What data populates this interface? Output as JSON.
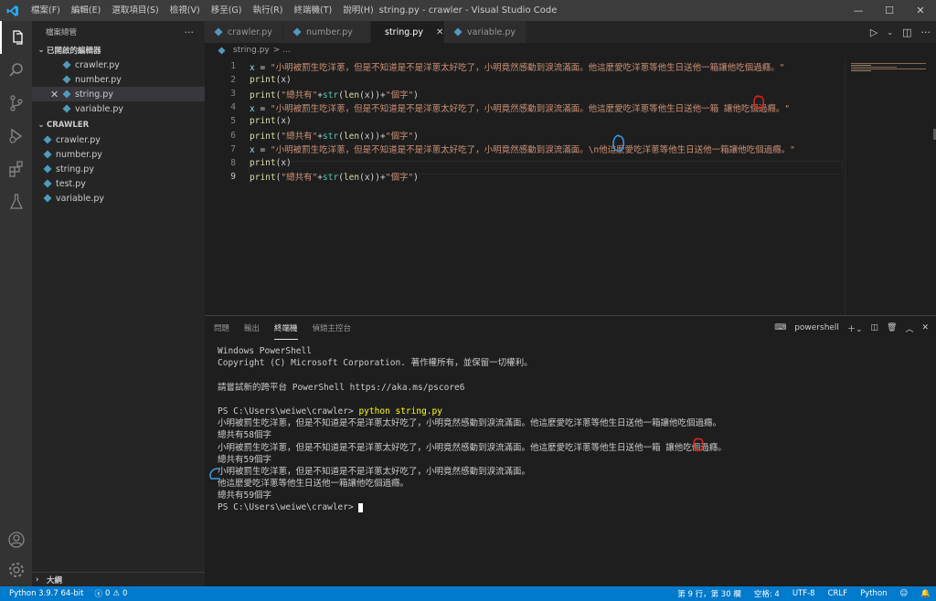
{
  "titlebar": {
    "menus": [
      "檔案(F)",
      "編輯(E)",
      "選取項目(S)",
      "檢視(V)",
      "移至(G)",
      "執行(R)",
      "終端機(T)",
      "說明(H)"
    ],
    "title": "string.py - crawler - Visual Studio Code"
  },
  "sidebar": {
    "header": "檔案總管",
    "open_editors_label": "已開啟的編輯器",
    "open_editors": [
      "crawler.py",
      "number.py",
      "string.py",
      "variable.py"
    ],
    "folder_label": "CRAWLER",
    "files": [
      "crawler.py",
      "number.py",
      "string.py",
      "test.py",
      "variable.py"
    ],
    "outline_label": "大綱"
  },
  "tabs": [
    {
      "label": "crawler.py"
    },
    {
      "label": "number.py"
    },
    {
      "label": "string.py"
    },
    {
      "label": "variable.py"
    }
  ],
  "breadcrumb": {
    "file": "string.py",
    "sep": "> ..."
  },
  "editor": {
    "lines": [
      {
        "n": "1",
        "parts": [
          [
            "kw-var",
            "x"
          ],
          [
            "op",
            " = "
          ],
          [
            "str",
            "\"小明被罰生吃洋蔥，但是不知道是不是洋蔥太好吃了，小明竟然感動到淚流滿面。他這麼愛吃洋蔥等他生日送他一箱讓他吃個過癮。\""
          ]
        ]
      },
      {
        "n": "2",
        "parts": [
          [
            "fn",
            "print"
          ],
          [
            "op",
            "(x)"
          ]
        ]
      },
      {
        "n": "3",
        "parts": [
          [
            "fn",
            "print"
          ],
          [
            "op",
            "("
          ],
          [
            "str",
            "\"總共有\""
          ],
          [
            "op",
            "+"
          ],
          [
            "bi",
            "str"
          ],
          [
            "op",
            "("
          ],
          [
            "fn",
            "len"
          ],
          [
            "op",
            "(x))+"
          ],
          [
            "str",
            "\"個字\""
          ],
          [
            "op",
            ")"
          ]
        ]
      },
      {
        "n": "4",
        "parts": [
          [
            "kw-var",
            "x"
          ],
          [
            "op",
            " = "
          ],
          [
            "str",
            "\"小明被罰生吃洋蔥，但是不知道是不是洋蔥太好吃了，小明竟然感動到淚流滿面。他這麼愛吃洋蔥等他生日送他一箱 讓他吃個過癮。\""
          ]
        ]
      },
      {
        "n": "5",
        "parts": [
          [
            "fn",
            "print"
          ],
          [
            "op",
            "(x)"
          ]
        ]
      },
      {
        "n": "6",
        "parts": [
          [
            "fn",
            "print"
          ],
          [
            "op",
            "("
          ],
          [
            "str",
            "\"總共有\""
          ],
          [
            "op",
            "+"
          ],
          [
            "bi",
            "str"
          ],
          [
            "op",
            "("
          ],
          [
            "fn",
            "len"
          ],
          [
            "op",
            "(x))+"
          ],
          [
            "str",
            "\"個字\""
          ],
          [
            "op",
            ")"
          ]
        ]
      },
      {
        "n": "7",
        "parts": [
          [
            "kw-var",
            "x"
          ],
          [
            "op",
            " = "
          ],
          [
            "str",
            "\"小明被罰生吃洋蔥，但是不知道是不是洋蔥太好吃了，小明竟然感動到淚流滿面。\\n他這麼愛吃洋蔥等他生日送他一箱讓他吃個過癮。\""
          ]
        ]
      },
      {
        "n": "8",
        "parts": [
          [
            "fn",
            "print"
          ],
          [
            "op",
            "(x)"
          ]
        ]
      },
      {
        "n": "9",
        "parts": [
          [
            "fn",
            "print"
          ],
          [
            "op",
            "("
          ],
          [
            "str",
            "\"總共有\""
          ],
          [
            "op",
            "+"
          ],
          [
            "bi",
            "str"
          ],
          [
            "op",
            "("
          ],
          [
            "fn",
            "len"
          ],
          [
            "op",
            "(x))+"
          ],
          [
            "str",
            "\"個字\""
          ],
          [
            "op",
            ")"
          ]
        ]
      }
    ]
  },
  "panel": {
    "tabs": [
      "問題",
      "輸出",
      "終端機",
      "偵錯主控台"
    ],
    "shell": "powershell"
  },
  "terminal": {
    "lines": [
      "Windows PowerShell",
      "Copyright (C) Microsoft Corporation. 著作權所有，並保留一切權利。",
      "",
      "請嘗試新的跨平台 PowerShell https://aka.ms/pscore6",
      "",
      "PS C:\\Users\\weiwe\\crawler> ",
      "小明被罰生吃洋蔥，但是不知道是不是洋蔥太好吃了，小明竟然感動到淚流滿面。他這麼愛吃洋蔥等他生日送他一箱讓他吃個過癮。",
      "總共有58個字",
      "小明被罰生吃洋蔥，但是不知道是不是洋蔥太好吃了，小明竟然感動到淚流滿面。他這麼愛吃洋蔥等他生日送他一箱 讓他吃個過癮。",
      "總共有59個字",
      "小明被罰生吃洋蔥，但是不知道是不是洋蔥太好吃了，小明竟然感動到淚流滿面。",
      "他這麼愛吃洋蔥等他生日送他一箱讓他吃個過癮。",
      "總共有59個字",
      "PS C:\\Users\\weiwe\\crawler> "
    ],
    "command": "python string.py"
  },
  "statusbar": {
    "python": "Python 3.9.7 64-bit",
    "errors": "0",
    "warnings": "0",
    "position": "第 9 行，第 30 欄",
    "spaces": "空格: 4",
    "encoding": "UTF-8",
    "eol": "CRLF",
    "language": "Python"
  },
  "colors": {
    "accent": "#007acc",
    "annotation_red": "#e02020",
    "annotation_blue": "#3a9be0"
  }
}
